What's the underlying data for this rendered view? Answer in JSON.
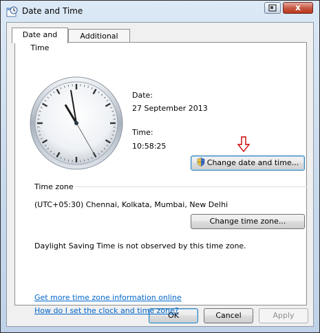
{
  "window": {
    "title": "Date and Time",
    "help_label": "?",
    "close_label": "x"
  },
  "tabs": [
    {
      "label": "Date and Time",
      "active": true
    },
    {
      "label": "Additional Clocks",
      "active": false
    }
  ],
  "clock": {
    "hour": 10,
    "minute": 58,
    "second": 25
  },
  "date": {
    "label": "Date:",
    "value": "27 September 2013"
  },
  "time": {
    "label": "Time:",
    "value": "10:58:25"
  },
  "buttons": {
    "change_date_time": "Change date and time...",
    "change_time_zone": "Change time zone...",
    "ok": "OK",
    "cancel": "Cancel",
    "apply": "Apply"
  },
  "timezone": {
    "section_label": "Time zone",
    "value": "(UTC+05:30) Chennai, Kolkata, Mumbai, New Delhi",
    "dst_note": "Daylight Saving Time is not observed by this time zone."
  },
  "links": {
    "more_info": "Get more time zone information online",
    "how_to": "How do I set the clock and time zone?"
  },
  "colors": {
    "link": "#0066cc",
    "arrow": "#cc0000"
  }
}
